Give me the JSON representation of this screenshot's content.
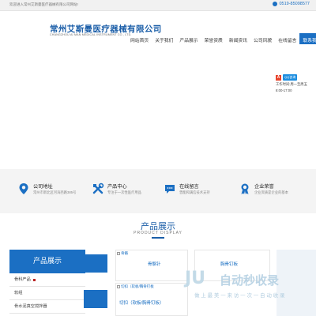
{
  "topbar": {
    "welcome": "欢迎进入常州艾斯曼医疗器械有限公司网站!",
    "phone": "0519-85098577"
  },
  "header": {
    "logo_cn": "常州艾斯曼医疗器械有限公司",
    "logo_en": "CHANGZHOU AI MAN MEDICAL INSTRUMENT CO., LTD."
  },
  "nav": {
    "items": [
      "网站首页",
      "关于我们",
      "产品展示",
      "荣誉资质",
      "新闻资讯",
      "公司风貌",
      "在线留言",
      "联系我们"
    ]
  },
  "float_panel": {
    "qq_label": "QQ咨询",
    "line1": "工作时间:周一至周五",
    "line2": "8:00-17:00"
  },
  "features": [
    {
      "title": "公司地址",
      "desc": "常州市新北区河海西路385号",
      "icon": "location-pin-icon"
    },
    {
      "title": "产品中心",
      "desc": "专注于一次性医疗用品",
      "icon": "tools-icon"
    },
    {
      "title": "在线留言",
      "desc": "曾能和满信技术支持",
      "icon": "chat-bubble-icon"
    },
    {
      "title": "企业荣誉",
      "desc": "企业资质是企业的基本",
      "icon": "award-medal-icon"
    }
  ],
  "products": {
    "title": "产品展示",
    "subtitle": "PRODUCT DISPLAY",
    "side_title": "产品展示",
    "categories": [
      "骨科产品",
      "软组",
      "骨水泥真空搅拌器"
    ],
    "cards": [
      {
        "alt": "骨骼",
        "label": "骨骼针"
      },
      {
        "alt": "胸骨钉板",
        "label": "胸骨钉板"
      },
      {
        "alt": "切扣（软板/胸骨钉板",
        "label": "切扣（软板/胸骨钉板）"
      }
    ]
  },
  "watermark": {
    "brand": "自动秒收录",
    "slogan": "做 上 最 美 一 来 访 一 次 一 自 动 收 录"
  },
  "colors": {
    "brand_blue": "#1b6fc3",
    "title_blue": "#1b5ea8",
    "feature_bg": "#f4f4f4"
  }
}
